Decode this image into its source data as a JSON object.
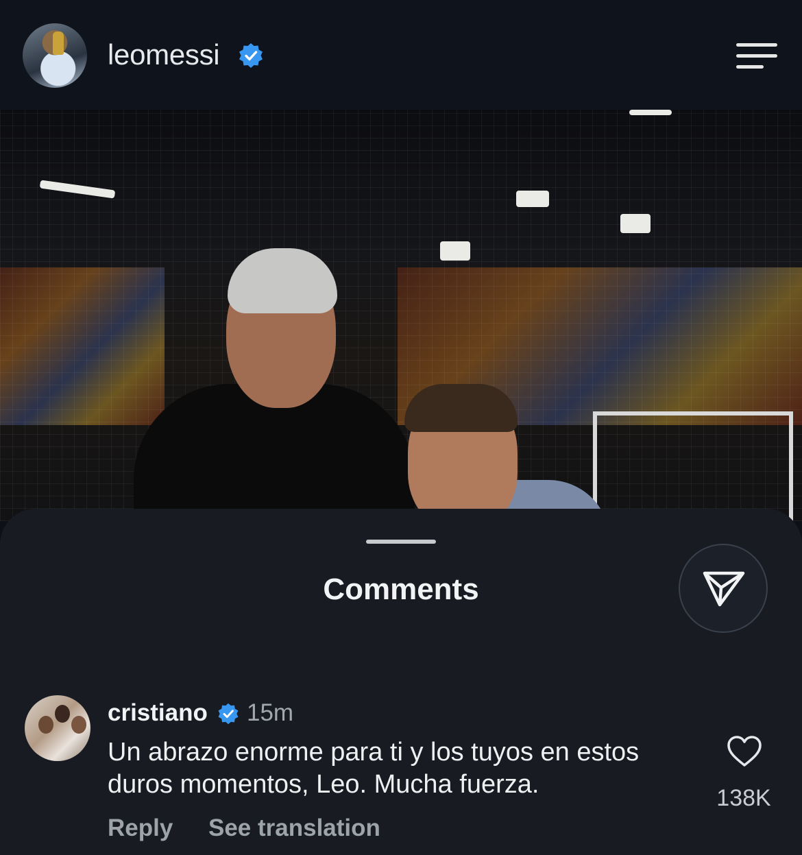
{
  "header": {
    "username": "leomessi",
    "verified": true,
    "avatar_icon": "profile-photo-with-trophy",
    "menu_icon": "hamburger-menu-icon"
  },
  "post": {
    "image_description_icon": "post-photo"
  },
  "comments_sheet": {
    "title": "Comments",
    "share_icon": "send-paper-plane-icon",
    "comments": [
      {
        "username": "cristiano",
        "verified": true,
        "time": "15m",
        "text": "Un abrazo enorme para ti y los tuyos en estos duros momentos, Leo. Mucha fuerza.",
        "likes": "138K",
        "reply_label": "Reply",
        "translate_label": "See translation"
      }
    ]
  },
  "colors": {
    "background": "#0d1117",
    "sheet": "#181b22",
    "verified_blue": "#3897f0",
    "text_primary": "#f2f3f5",
    "text_secondary": "#9da3ab"
  }
}
